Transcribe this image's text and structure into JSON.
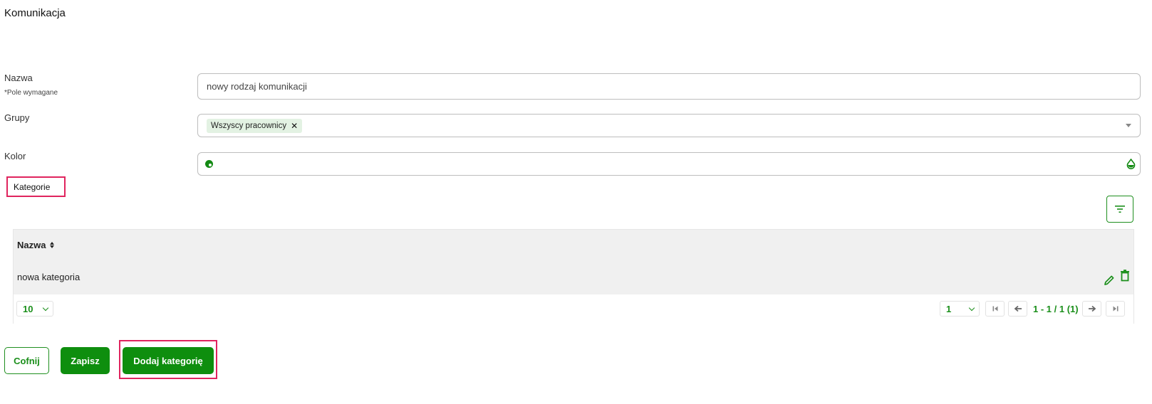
{
  "page": {
    "title": "Komunikacja"
  },
  "form": {
    "name_label": "Nazwa",
    "required_note": "*Pole wymagane",
    "name_value": "nowy rodzaj komunikacji",
    "groups_label": "Grupy",
    "groups_chips": [
      "Wszyscy pracownicy"
    ],
    "chip_remove": "✕",
    "color_label": "Kolor"
  },
  "categories": {
    "section_label": "Kategorie",
    "table": {
      "header_name": "Nazwa",
      "rows": [
        {
          "name": "nowa kategoria"
        }
      ]
    },
    "footer": {
      "page_size": "10",
      "current_page": "1",
      "page_info": "1 - 1 / 1 (1)"
    }
  },
  "actions": {
    "back_label": "Cofnij",
    "save_label": "Zapisz",
    "add_category_label": "Dodaj kategorię"
  },
  "colors": {
    "accent": "#0e8e0e",
    "highlight": "#e0245e",
    "chip_bg": "#e3f2e3",
    "table_bg": "#f0f0f0"
  },
  "icons": {
    "palette": "palette-icon",
    "drop": "color-drop-icon",
    "filter": "filter-icon",
    "sort": "sort-icon",
    "edit": "pencil-icon",
    "delete": "trash-icon",
    "first": "first-page-icon",
    "prev": "previous-page-icon",
    "next": "next-page-icon",
    "last": "last-page-icon"
  }
}
